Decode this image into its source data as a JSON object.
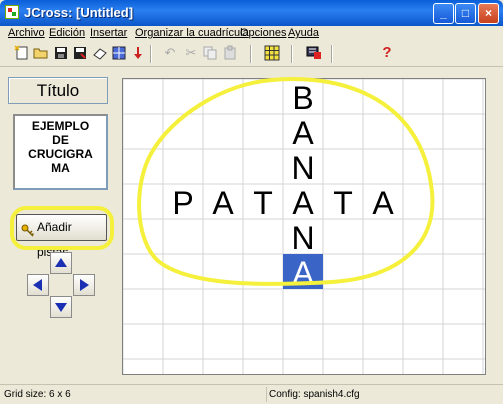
{
  "window": {
    "title": "JCross: [Untitled]",
    "min_label": "_",
    "max_label": "□",
    "close_label": "×"
  },
  "menu": [
    {
      "label": "Archivo"
    },
    {
      "label": "Edición"
    },
    {
      "label": "Insertar"
    },
    {
      "label": "Organizar la cuadrícula"
    },
    {
      "label": "Opciones"
    },
    {
      "label": "Ayuda"
    }
  ],
  "toolbar": {
    "icons": [
      "new-file-icon",
      "open-folder-icon",
      "save-icon",
      "save-as-icon",
      "eraser-icon",
      "web-export-icon",
      "down-arrow-icon",
      "undo-icon",
      "cut-icon",
      "copy-icon",
      "paste-icon",
      "grid-icon",
      "flag-icon",
      "help-icon"
    ],
    "help_label": "?"
  },
  "left_panel": {
    "title": "Título",
    "subtitle": "EJEMPLO\nDE\nCRUCIGRA\nMA",
    "add_clues_label": "Añadir pistas"
  },
  "grid": {
    "cols": 9,
    "rows": 7,
    "cells": [
      {
        "row": 0,
        "col": 4,
        "letter": "B",
        "selected": false
      },
      {
        "row": 1,
        "col": 4,
        "letter": "A",
        "selected": false
      },
      {
        "row": 2,
        "col": 4,
        "letter": "N",
        "selected": false
      },
      {
        "row": 3,
        "col": 1,
        "letter": "P",
        "selected": false
      },
      {
        "row": 3,
        "col": 2,
        "letter": "A",
        "selected": false
      },
      {
        "row": 3,
        "col": 3,
        "letter": "T",
        "selected": false
      },
      {
        "row": 3,
        "col": 4,
        "letter": "A",
        "selected": false
      },
      {
        "row": 3,
        "col": 5,
        "letter": "T",
        "selected": false
      },
      {
        "row": 3,
        "col": 6,
        "letter": "A",
        "selected": false
      },
      {
        "row": 4,
        "col": 4,
        "letter": "N",
        "selected": false
      },
      {
        "row": 5,
        "col": 4,
        "letter": "A",
        "selected": true
      }
    ],
    "selection_color": "#3a64c6",
    "highlight_color": "#f5f03c"
  },
  "status": {
    "grid_size": "Grid size: 6 x 6",
    "config": "Config: spanish4.cfg"
  },
  "colors": {
    "titlebar": "#0a5fd8",
    "arrow": "#1a2fb4"
  }
}
